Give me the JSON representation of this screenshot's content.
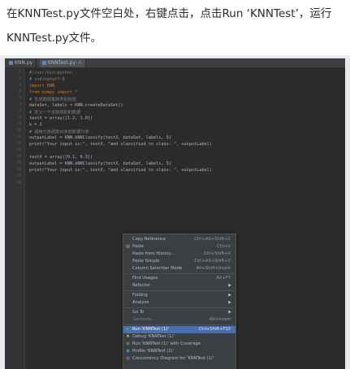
{
  "caption": "在KNNTest.py文件空白处，右键点击，点击Run ‘KNNTest’，运行KNNTest.py文件。",
  "tabs": [
    {
      "label": "KNN.py",
      "icon": "python-file-icon",
      "active": false
    },
    {
      "label": "KNNTest.py",
      "icon": "python-file-icon",
      "active": true
    }
  ],
  "line_numbers": [
    "1",
    "2",
    "3",
    "4",
    "5",
    "6",
    "7",
    "8",
    "9",
    "10",
    "11",
    "12",
    "13",
    "14",
    "15",
    "16",
    "17",
    "18"
  ],
  "code_lines": [
    "#!/usr/bin/python",
    "# coding=utf-8",
    "import KNN",
    "from numpy import *",
    "# 生成数据集和类别标签",
    "dataSet, labels = KNN.createDataSet()",
    "# 定义一个未知类别的数据",
    "testX = array([1.2, 1.0])",
    "k = 3",
    "# 调用分类函数对未知数据分类",
    "outputLabel = KNN.kNNClassify(testX, dataSet, labels, 3)",
    "print(\"Your input is:\", testX, \"and classified to class: \", outputLabel)",
    "",
    "testX = array([0.1, 0.3])",
    "outputLabel = KNN.kNNClassify(testX, dataSet, labels, 3)",
    "print(\"Your input is:\", testX, \"and classified to class: \", outputLabel)"
  ],
  "menu": [
    {
      "label": "Copy Reference",
      "shortcut": "Ctrl+Alt+Shift+C"
    },
    {
      "label": "Paste",
      "shortcut": "Ctrl+V"
    },
    {
      "label": "Paste from History...",
      "shortcut": "Ctrl+Shift+V"
    },
    {
      "label": "Paste Simple",
      "shortcut": "Ctrl+Alt+Shift+V"
    },
    {
      "label": "Column Selection Mode",
      "shortcut": "Alt+Shift+Insert"
    },
    {
      "label": "Find Usages",
      "shortcut": "Alt+F7"
    },
    {
      "label": "Refactor",
      "shortcut": ""
    },
    {
      "label": "Folding",
      "shortcut": ""
    },
    {
      "label": "Analyze",
      "shortcut": ""
    },
    {
      "label": "Go To",
      "shortcut": ""
    },
    {
      "label": "Generate...",
      "shortcut": "Alt+Insert"
    },
    {
      "label": "Run 'KNNTest (1)'",
      "shortcut": "Ctrl+Shift+F10"
    },
    {
      "label": "Debug 'KNNTest (1)'",
      "shortcut": ""
    },
    {
      "label": "Run 'KNNTest (1)' with Coverage",
      "shortcut": ""
    },
    {
      "label": "Profile 'KNNTest (1)'",
      "shortcut": ""
    },
    {
      "label": "Concurrency Diagram for 'KNNTest (1)'",
      "shortcut": ""
    }
  ],
  "colors": {
    "editor_bg": "#2b2b2b",
    "menu_bg": "#3c3f41",
    "selection": "#4b6eaf"
  }
}
